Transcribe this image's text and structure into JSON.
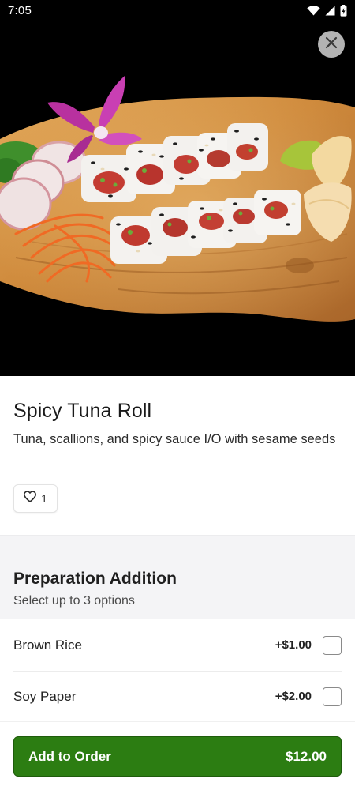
{
  "status_bar": {
    "time": "7:05",
    "icons": [
      "wifi-icon",
      "cellular-signal-icon",
      "battery-icon"
    ]
  },
  "hero": {
    "image_subject": "sushi-roll-photo",
    "close_icon": "close-icon"
  },
  "item": {
    "title": "Spicy Tuna Roll",
    "description": "Tuna, scallions, and spicy sauce I/O with sesame seeds",
    "like_icon": "heart-icon",
    "like_count": "1"
  },
  "modifier_group": {
    "title": "Preparation Addition",
    "subtitle": "Select up to 3 options",
    "options": [
      {
        "label": "Brown Rice",
        "price": "+$1.00",
        "checked": false
      },
      {
        "label": "Soy Paper",
        "price": "+$2.00",
        "checked": false
      }
    ]
  },
  "cta": {
    "label": "Add to Order",
    "price": "$12.00"
  },
  "colors": {
    "primary_green": "#2c7d12",
    "section_background": "#f4f4f6"
  }
}
